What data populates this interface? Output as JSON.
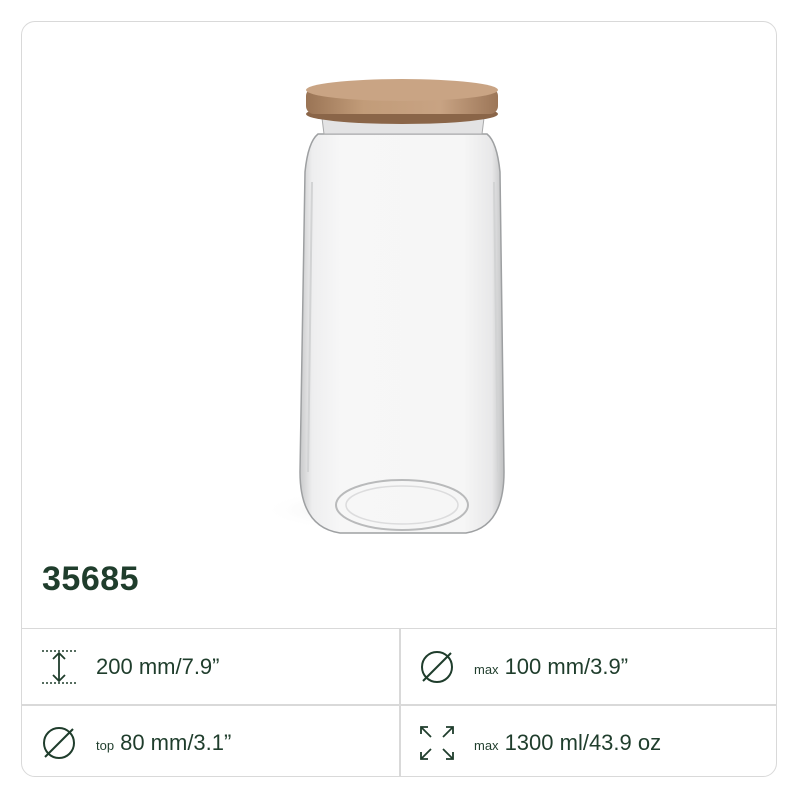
{
  "product": {
    "sku": "35685",
    "image_icon": "glass-jar-with-wooden-lid"
  },
  "specs": {
    "height": {
      "value": "200 mm/7.9”",
      "icon": "height-icon"
    },
    "max_diameter": {
      "prefix": "max",
      "value": "100 mm/3.9”",
      "icon": "diameter-icon"
    },
    "top_diameter": {
      "prefix": "top",
      "value": "80 mm/3.1”",
      "icon": "diameter-icon"
    },
    "max_volume": {
      "prefix": "max",
      "value": "1300 ml/43.9 oz",
      "icon": "expand-icon"
    }
  },
  "colors": {
    "accent": "#1f3d2c",
    "border": "#d9d9d9",
    "wood_lid": "#b8906c"
  }
}
